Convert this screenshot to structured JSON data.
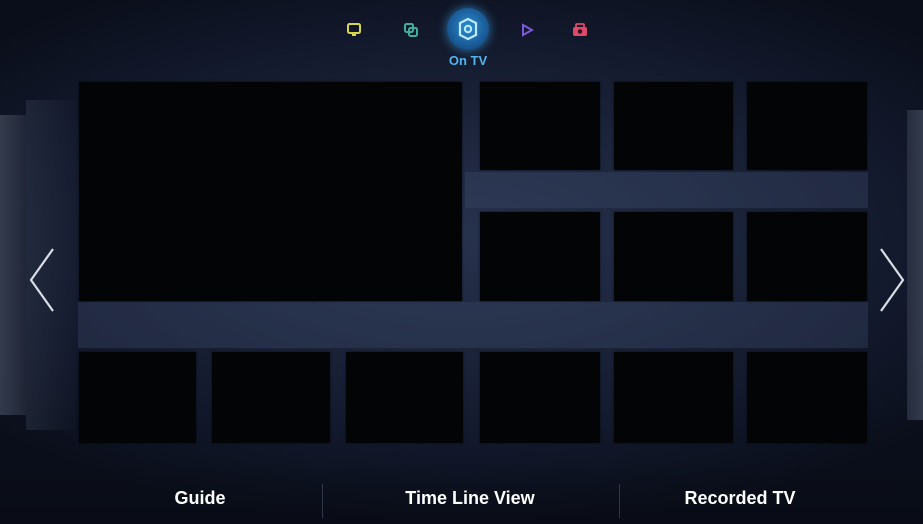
{
  "panels": {
    "active_label": "On TV",
    "icons": [
      {
        "name": "social-panel-icon",
        "color": "#d7d64a"
      },
      {
        "name": "apps-panel-icon",
        "color": "#3fae9a"
      },
      {
        "name": "on-tv-panel-icon",
        "color": "#8fd6ff"
      },
      {
        "name": "movies-tv-panel-icon",
        "color": "#7a5ad8"
      },
      {
        "name": "photos-videos-music-panel-icon",
        "color": "#e0486a"
      }
    ]
  },
  "navigation": {
    "left_arrow": "chevron-left-icon",
    "right_arrow": "chevron-right-icon"
  },
  "bottom_menu": {
    "guide": "Guide",
    "timeline": "Time Line View",
    "recorded": "Recorded TV"
  }
}
